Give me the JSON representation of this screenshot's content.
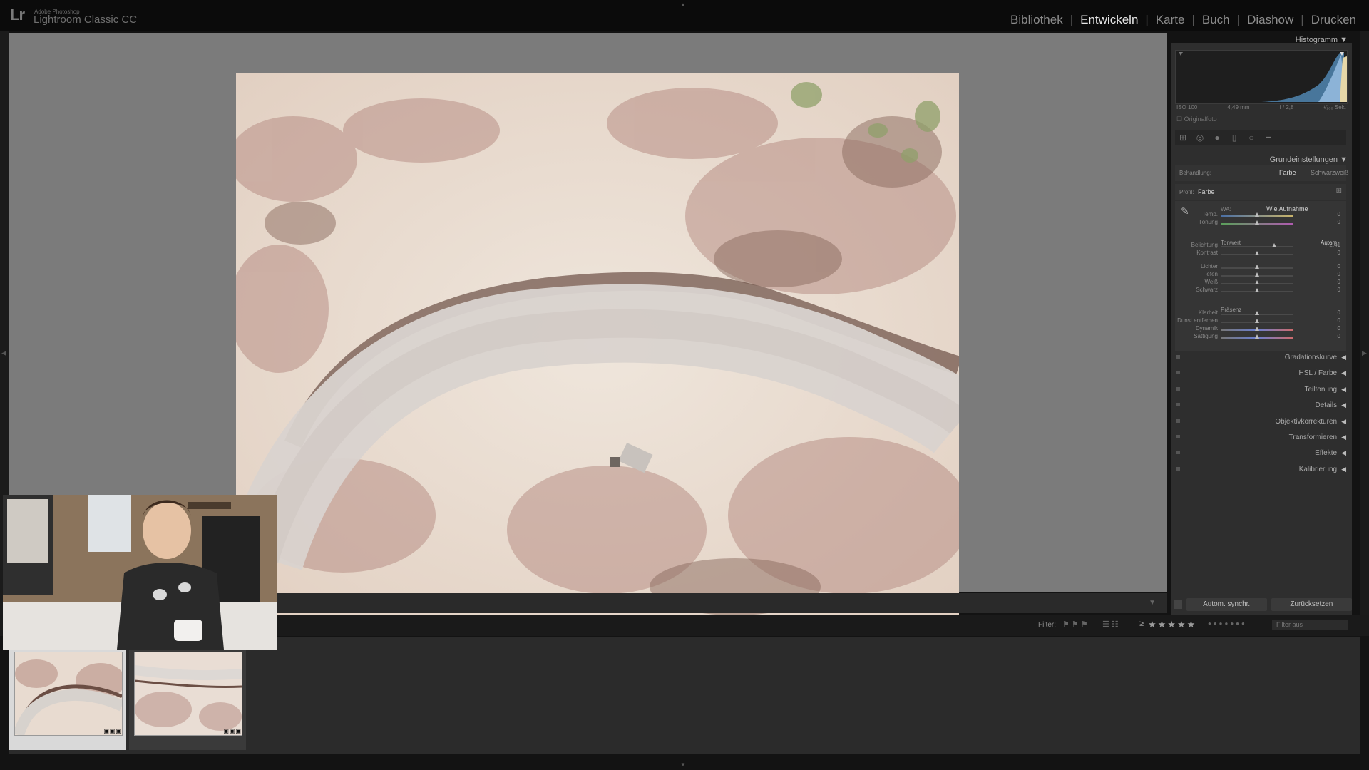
{
  "app": {
    "logo": "Lr",
    "brand_small": "Adobe Photoshop",
    "brand_name": "Lightroom Classic CC"
  },
  "modules": [
    {
      "label": "Bibliothek",
      "active": false
    },
    {
      "label": "Entwickeln",
      "active": true
    },
    {
      "label": "Karte",
      "active": false
    },
    {
      "label": "Buch",
      "active": false
    },
    {
      "label": "Diashow",
      "active": false
    },
    {
      "label": "Drucken",
      "active": false
    }
  ],
  "histogram": {
    "title": "Histogramm",
    "iso": "ISO 100",
    "focal": "4,49 mm",
    "aperture": "f / 2,8",
    "shutter": "¹⁄₁₀₀ Sek.",
    "original": "Originalfoto"
  },
  "basic": {
    "title": "Grundeinstellungen",
    "treatment_label": "Behandlung:",
    "treatment_color": "Farbe",
    "treatment_bw": "Schwarzweiß",
    "profile_label": "Profil:",
    "profile_value": "Farbe",
    "wb_label": "WA:",
    "wb_value": "Wie Aufnahme",
    "tone_label": "Tonwert",
    "auto_label": "Autom.",
    "presence_label": "Präsenz",
    "sliders": [
      {
        "label": "Temp.",
        "value": "0",
        "pos": 0.5
      },
      {
        "label": "Tönung",
        "value": "0",
        "pos": 0.5
      },
      {
        "label": "Belichtung",
        "value": "+ 2,41",
        "pos": 0.74
      },
      {
        "label": "Kontrast",
        "value": "0",
        "pos": 0.5
      },
      {
        "label": "Lichter",
        "value": "0",
        "pos": 0.5
      },
      {
        "label": "Tiefen",
        "value": "0",
        "pos": 0.5
      },
      {
        "label": "Weiß",
        "value": "0",
        "pos": 0.5
      },
      {
        "label": "Schwarz",
        "value": "0",
        "pos": 0.5
      },
      {
        "label": "Klarheit",
        "value": "0",
        "pos": 0.5
      },
      {
        "label": "Dunst entfernen",
        "value": "0",
        "pos": 0.5
      },
      {
        "label": "Dynamik",
        "value": "0",
        "pos": 0.5
      },
      {
        "label": "Sättigung",
        "value": "0",
        "pos": 0.5
      }
    ]
  },
  "panels": [
    {
      "label": "Gradationskurve"
    },
    {
      "label": "HSL / Farbe"
    },
    {
      "label": "Teiltonung"
    },
    {
      "label": "Details"
    },
    {
      "label": "Objektivkorrekturen"
    },
    {
      "label": "Transformieren"
    },
    {
      "label": "Effekte"
    },
    {
      "label": "Kalibrierung"
    }
  ],
  "buttons": {
    "sync": "Autom. synchr.",
    "reset": "Zurücksetzen"
  },
  "filmstrip": {
    "filter_label": "Filter:",
    "rating_prefix": "≥",
    "filter_value": "Filter aus"
  }
}
